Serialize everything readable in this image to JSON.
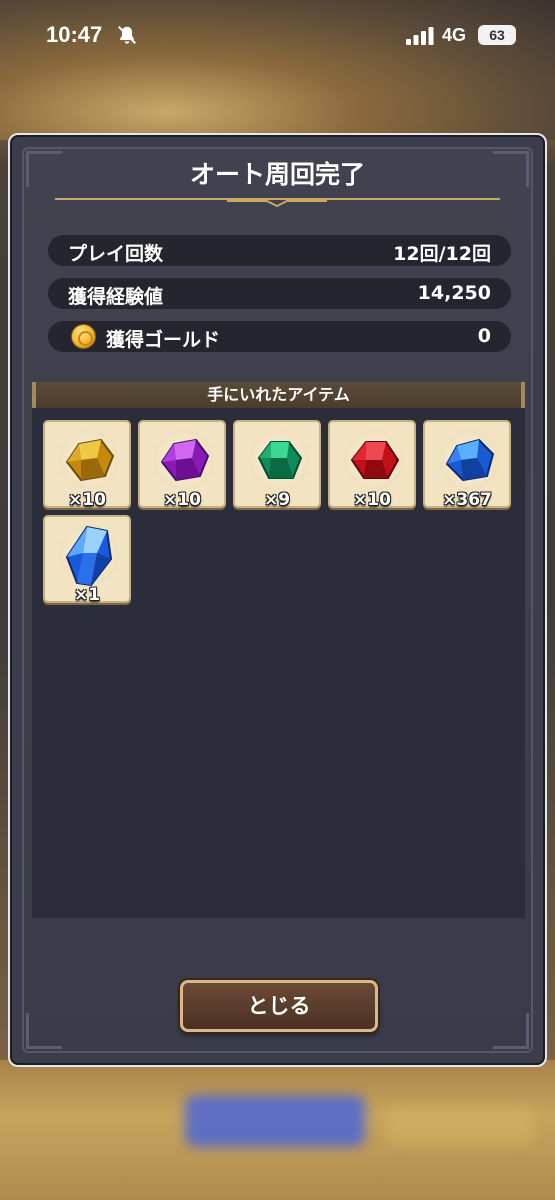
{
  "status_bar": {
    "time": "10:47",
    "network": "4G",
    "battery": "63"
  },
  "dialog": {
    "title": "オート周回完了",
    "stats": [
      {
        "label": "プレイ回数",
        "value": "12回/12回"
      },
      {
        "label": "獲得経験値",
        "value": "14,250"
      },
      {
        "label": "獲得ゴールド",
        "value": "0"
      }
    ],
    "items_header": "手にいれたアイテム",
    "items": [
      {
        "name": "gold-crystal-icon",
        "color": "#d8a21a",
        "quantity": "×10"
      },
      {
        "name": "purple-crystal-icon",
        "color": "#a030d8",
        "quantity": "×10"
      },
      {
        "name": "green-crystal-icon",
        "color": "#1aa86a",
        "quantity": "×9"
      },
      {
        "name": "red-crystal-icon",
        "color": "#d8202a",
        "quantity": "×10"
      },
      {
        "name": "blue-crystal-icon",
        "color": "#2a7ae8",
        "quantity": "×367"
      },
      {
        "name": "blue-shard-icon",
        "color": "#2a6ae8",
        "quantity": "×1"
      }
    ],
    "close_label": "とじる"
  }
}
